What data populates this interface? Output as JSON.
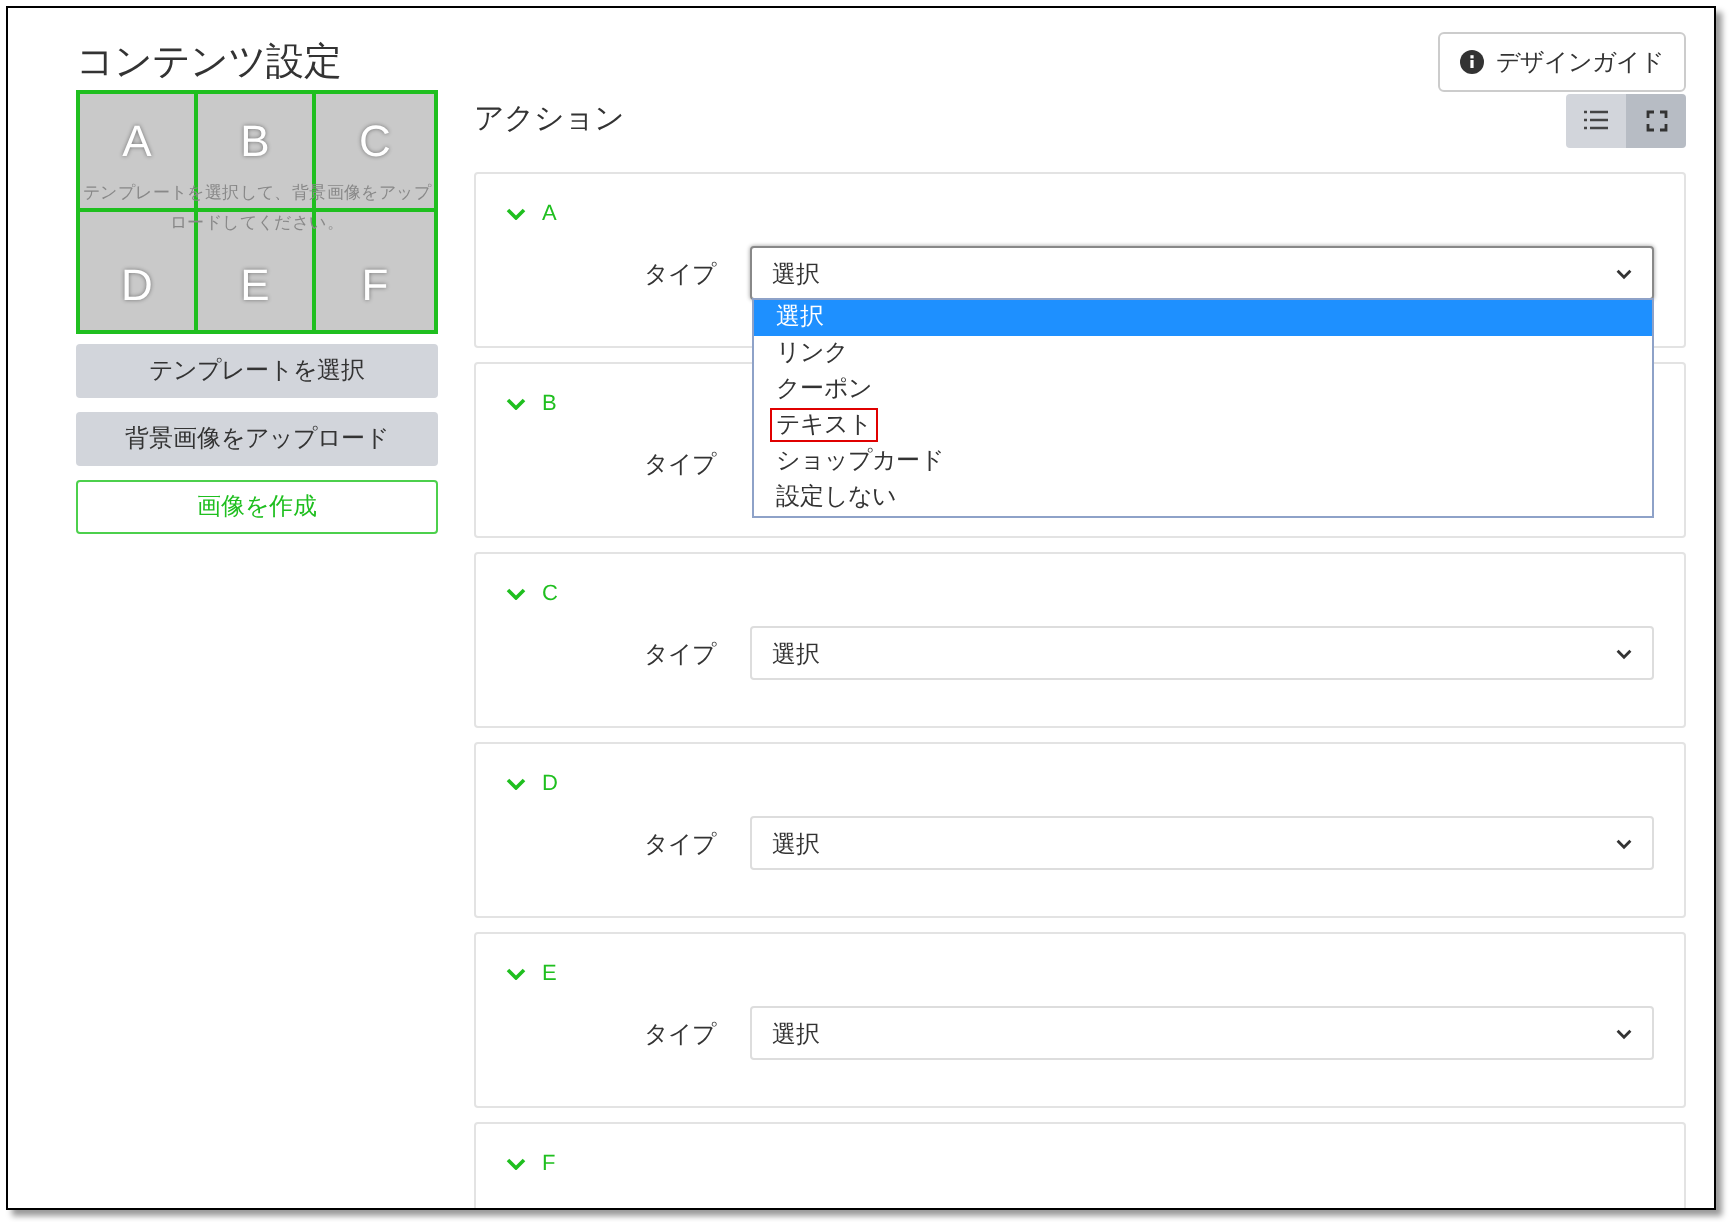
{
  "title": "コンテンツ設定",
  "design_guide_button": "デザインガイド",
  "template_areas": [
    "A",
    "B",
    "C",
    "D",
    "E",
    "F"
  ],
  "template_hint": "テンプレートを選択して、背景画像をアップロードしてください。",
  "left_buttons": [
    {
      "label": "テンプレートを選択",
      "kind": "secondary"
    },
    {
      "label": "背景画像をアップロード",
      "kind": "secondary"
    },
    {
      "label": "画像を作成",
      "kind": "outline"
    }
  ],
  "actions_title": "アクション",
  "view_toggles": [
    {
      "kind": "list",
      "selected": false
    },
    {
      "kind": "expand",
      "selected": true
    }
  ],
  "actions": [
    {
      "name": "A",
      "type_label": "タイプ",
      "value": "選択",
      "open": true
    },
    {
      "name": "B",
      "type_label": "タイプ",
      "open": false
    },
    {
      "name": "C",
      "type_label": "タイプ",
      "value": "選択",
      "open": false
    },
    {
      "name": "D",
      "type_label": "タイプ",
      "value": "選択",
      "open": false
    },
    {
      "name": "E",
      "type_label": "タイプ",
      "value": "選択",
      "open": false
    },
    {
      "name": "F"
    }
  ],
  "dropdown_options": [
    {
      "label": "選択",
      "selected": true,
      "highlighted": false
    },
    {
      "label": "リンク",
      "selected": false,
      "highlighted": false
    },
    {
      "label": "クーポン",
      "selected": false,
      "highlighted": false
    },
    {
      "label": "テキスト",
      "selected": false,
      "highlighted": true
    },
    {
      "label": "ショップカード",
      "selected": false,
      "highlighted": false
    },
    {
      "label": "設定しない",
      "selected": false,
      "highlighted": false
    }
  ]
}
